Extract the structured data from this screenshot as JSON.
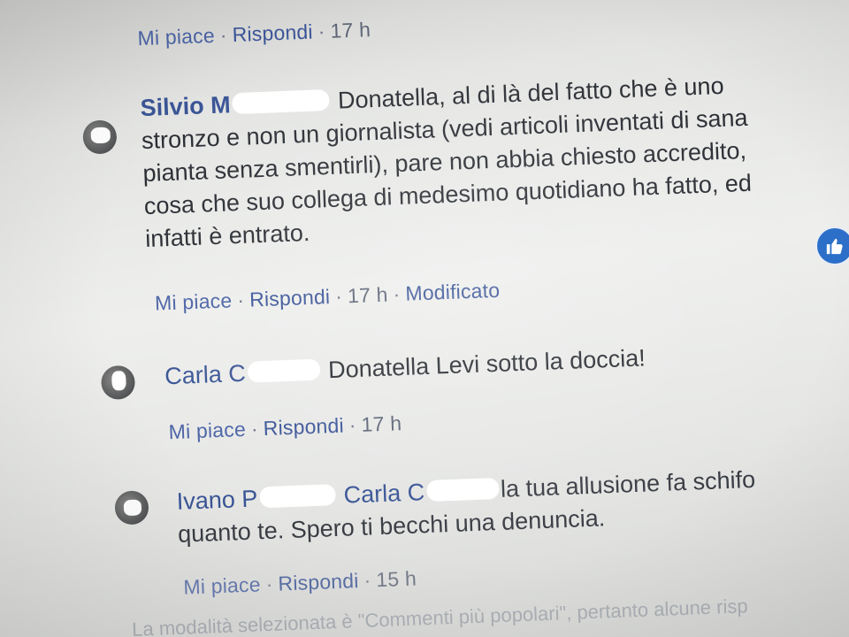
{
  "top_actions": {
    "like": "Mi piace",
    "reply": "Rispondi",
    "time": "17 h"
  },
  "comments": [
    {
      "author": "Silvio M",
      "lines": [
        "Donatella, al di là del fatto che è uno",
        "stronzo e non un giornalista (vedi articoli inventati di sana",
        "pianta senza smentirli), pare non abbia chiesto accredito,",
        "cosa che suo collega di medesimo quotidiano ha fatto, ed",
        "infatti è entrato."
      ],
      "actions": {
        "like": "Mi piace",
        "reply": "Rispondi",
        "time": "17 h",
        "edited": "Modificato"
      }
    },
    {
      "author": "Carla C",
      "lines": [
        "Donatella Levi sotto la doccia!"
      ],
      "actions": {
        "like": "Mi piace",
        "reply": "Rispondi",
        "time": "17 h"
      }
    },
    {
      "author": "Ivano P",
      "mention": "Carla C",
      "lines": [
        "la tua allusione fa schifo",
        "quanto te. Spero ti becchi una denuncia."
      ],
      "actions": {
        "like": "Mi piace",
        "reply": "Rispondi",
        "time": "15 h"
      }
    }
  ],
  "footer_note": "La modalità selezionata è \"Commenti più popolari\", pertanto alcune risp",
  "icons": {
    "like_badge": "thumbs-up-icon"
  },
  "colors": {
    "author": "#3a5596",
    "text": "#2a2d33",
    "link": "#3b5598",
    "like_badge": "#2c6fc9"
  }
}
